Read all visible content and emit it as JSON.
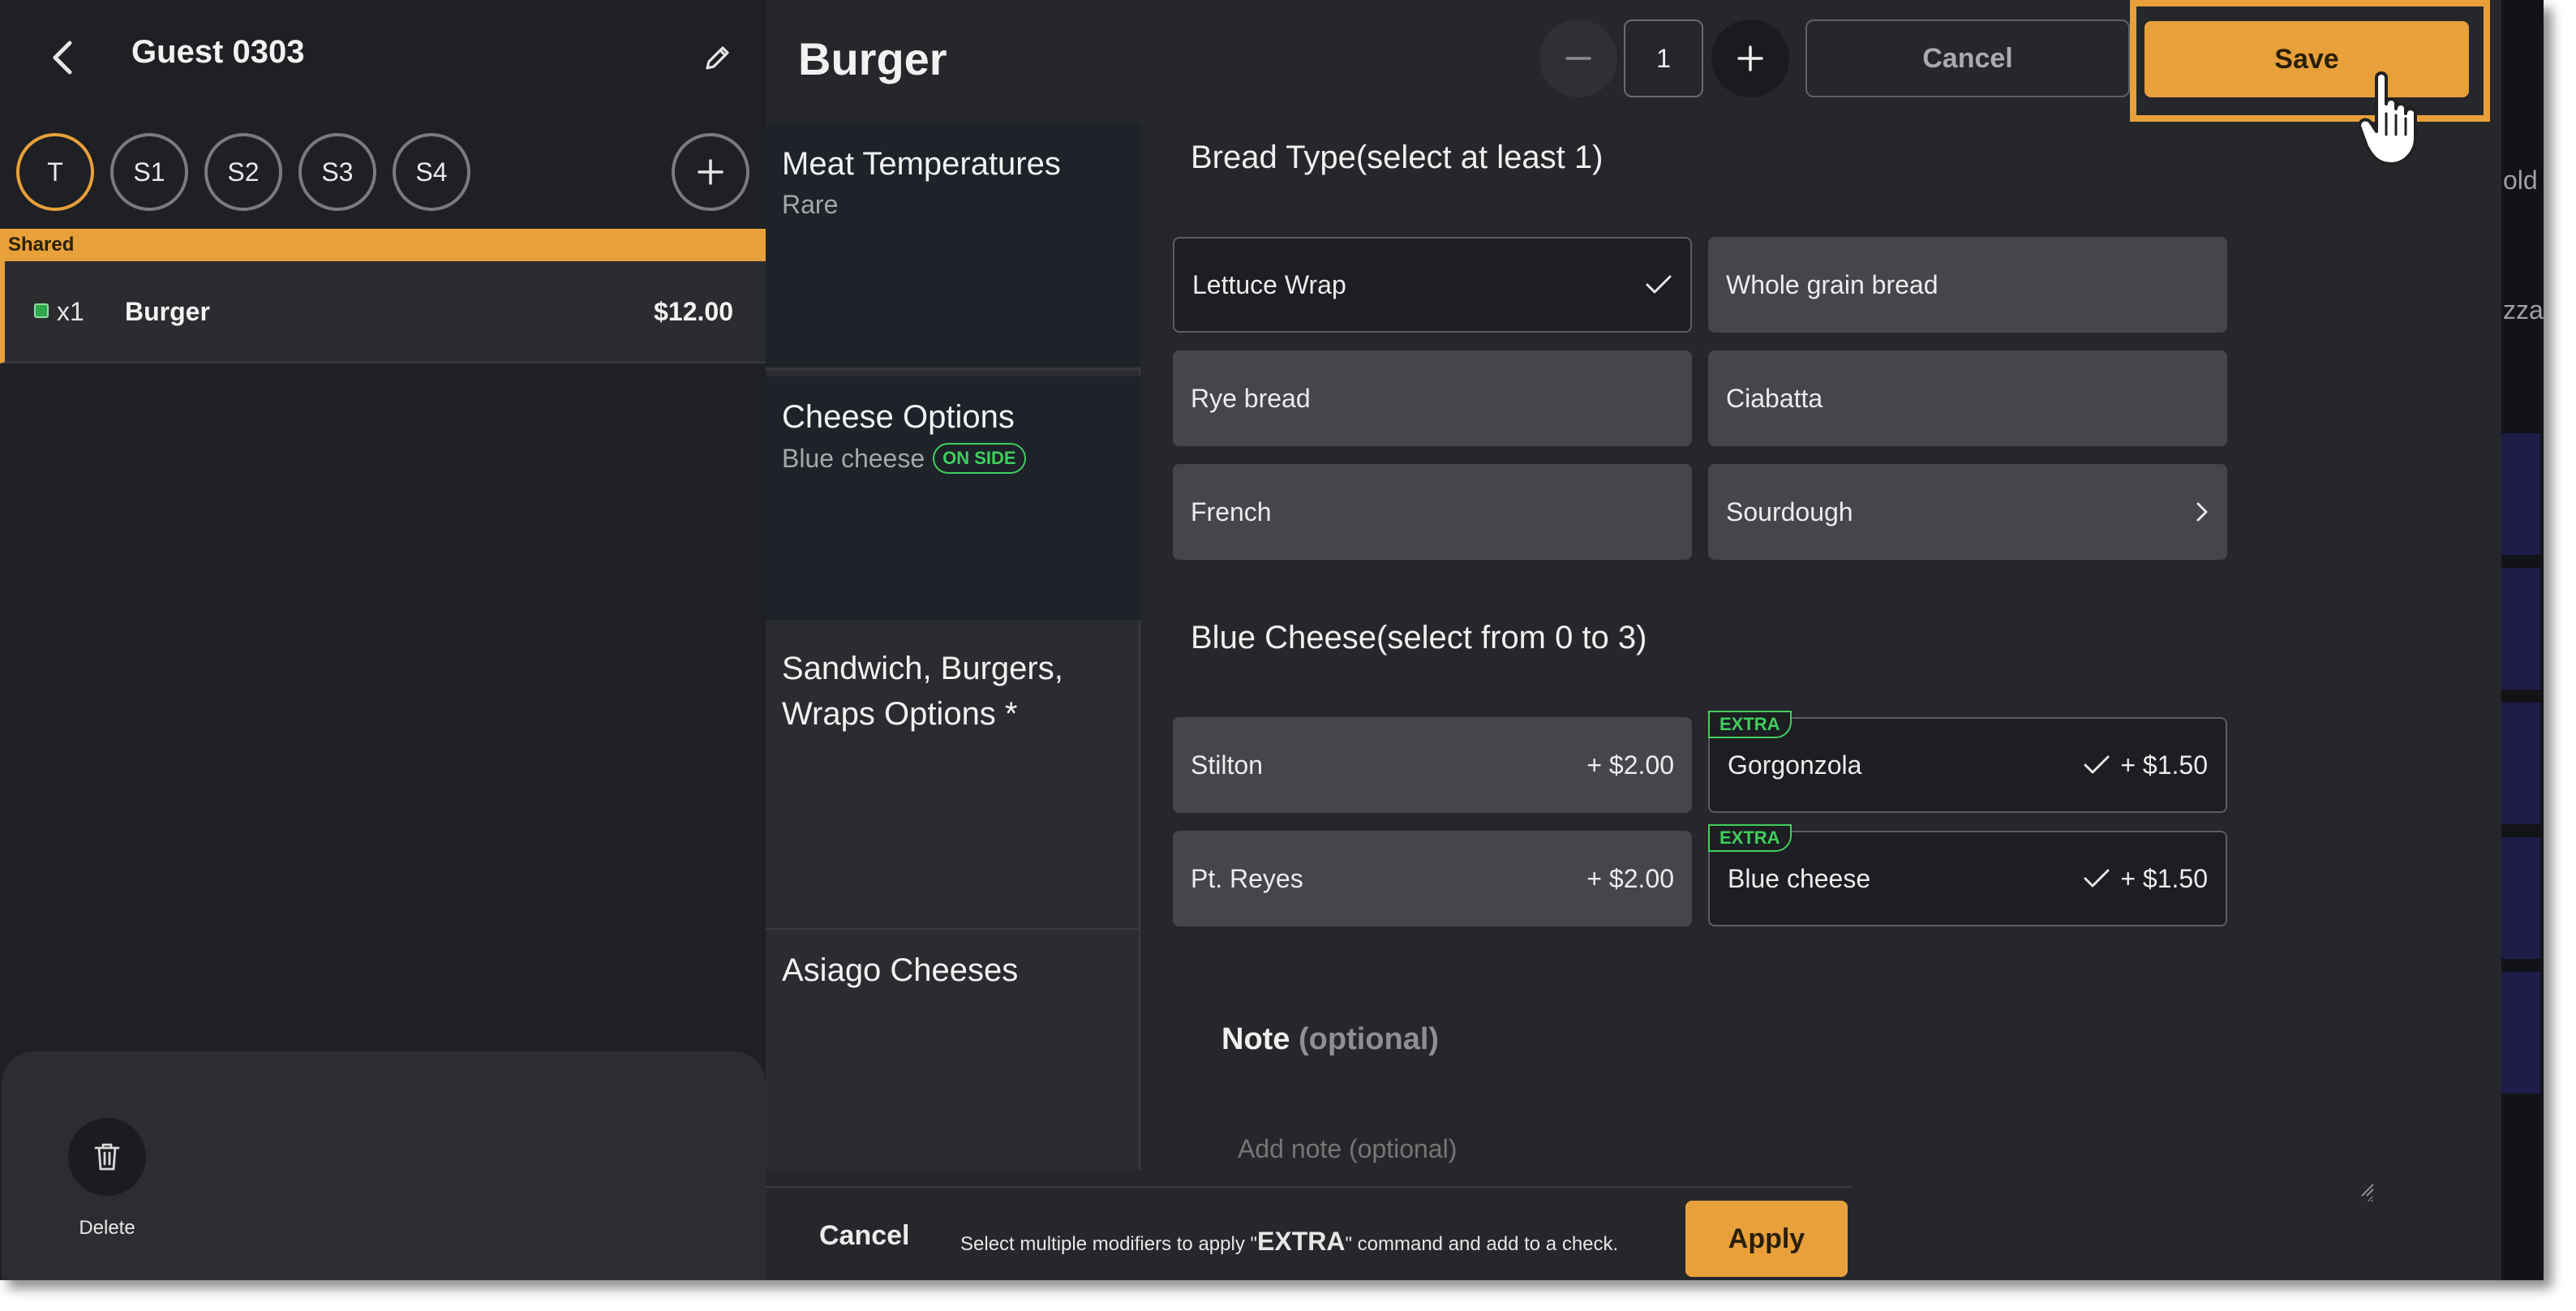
{
  "left_panel": {
    "guest_title": "Guest 0303",
    "seats": [
      "T",
      "S1",
      "S2",
      "S3",
      "S4"
    ],
    "shared_label": "Shared",
    "order_item": {
      "qty": "x1",
      "name": "Burger",
      "price": "$12.00"
    },
    "delete_label": "Delete"
  },
  "modal": {
    "title": "Burger",
    "quantity": "1",
    "cancel_label": "Cancel",
    "save_label": "Save",
    "categories": [
      {
        "name": "Meat Temperatures",
        "sub": "Rare"
      },
      {
        "name": "Cheese Options",
        "sub": "Blue cheese",
        "badge": "ON SIDE"
      },
      {
        "name": "Sandwich, Burgers, Wraps Options *",
        "sub": ""
      },
      {
        "name": "Asiago Cheeses",
        "sub": ""
      }
    ],
    "bread_section": {
      "title": "Bread Type",
      "hint": "(select at least 1)",
      "options": [
        {
          "label": "Lettuce Wrap",
          "selected": true
        },
        {
          "label": "Whole grain bread"
        },
        {
          "label": "Rye bread"
        },
        {
          "label": "Ciabatta"
        },
        {
          "label": "French"
        },
        {
          "label": "Sourdough",
          "has_submenu": true
        }
      ]
    },
    "cheese_section": {
      "title": "Blue Cheese",
      "hint": "(select from 0 to 3)",
      "options": [
        {
          "label": "Stilton",
          "price": "+ $2.00"
        },
        {
          "label": "Gorgonzola",
          "price": "+ $1.50",
          "selected": true,
          "tag": "EXTRA"
        },
        {
          "label": "Pt. Reyes",
          "price": "+ $2.00"
        },
        {
          "label": "Blue cheese",
          "price": "+ $1.50",
          "selected": true,
          "tag": "EXTRA"
        }
      ]
    },
    "note": {
      "title": "Note",
      "title_hint": "(optional)",
      "placeholder": "Add note (optional)"
    },
    "bottom_bar": {
      "cancel_label": "Cancel",
      "hint_prefix": "Select multiple modifiers to apply \"",
      "hint_keyword": "EXTRA",
      "hint_suffix": "\" command and add to a check.",
      "apply_label": "Apply"
    }
  },
  "background_peek": {
    "texts": [
      "old",
      "zza"
    ]
  },
  "colors": {
    "accent": "#e8a03a",
    "extra_green": "#3fcf5d",
    "panel_bg": "#1f2024",
    "modal_bg": "#26272b"
  }
}
